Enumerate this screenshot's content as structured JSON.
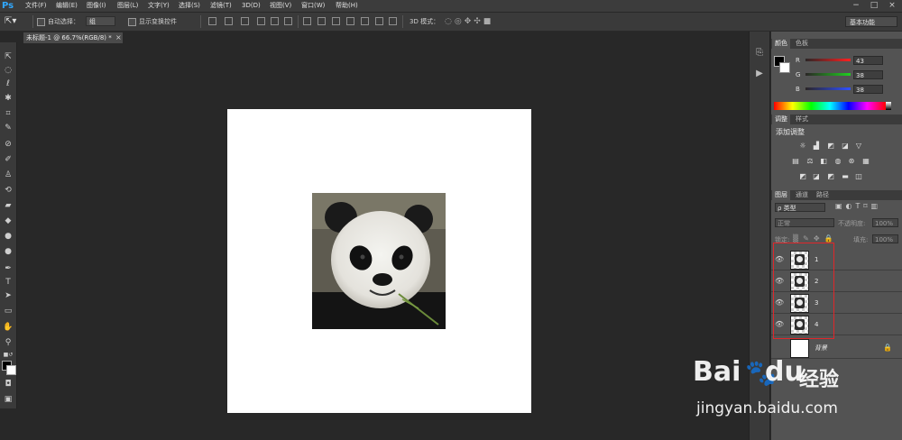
{
  "app": {
    "logo": "Ps"
  },
  "menu": [
    "文件(F)",
    "编辑(E)",
    "图像(I)",
    "图层(L)",
    "文字(Y)",
    "选择(S)",
    "滤镜(T)",
    "3D(D)",
    "视图(V)",
    "窗口(W)",
    "帮助(H)"
  ],
  "window_controls": [
    "−",
    "□",
    "×"
  ],
  "options": {
    "auto_select_label": "自动选择：",
    "auto_select_value": "组",
    "show_transform_label": "显示变换控件",
    "mode_3d_label": "3D 模式：",
    "workspace": "基本功能"
  },
  "document_tab": {
    "title": "未标题-1 @ 66.7%(RGB/8) *",
    "close": "×"
  },
  "colors": {
    "canvas_bg": "#ffffff",
    "app_bg": "#282828",
    "panel_bg": "#535353",
    "highlight": "#e0262a",
    "foreground": "#000000",
    "background": "#ffffff"
  },
  "color_panel": {
    "tabs": [
      "颜色",
      "色板"
    ],
    "channels": [
      {
        "label": "R",
        "value": "43",
        "color": "#ff2020"
      },
      {
        "label": "G",
        "value": "38",
        "color": "#20d020"
      },
      {
        "label": "B",
        "value": "38",
        "color": "#3050ff"
      }
    ]
  },
  "adjust_panel": {
    "tabs": [
      "调整",
      "样式"
    ],
    "title": "添加调整"
  },
  "layers_panel": {
    "tabs": [
      "图层",
      "通道",
      "路径"
    ],
    "filter_label": "ρ 类型",
    "blend_mode": "正常",
    "opacity_label": "不透明度:",
    "opacity_value": "100%",
    "lock_label": "锁定:",
    "fill_label": "填充:",
    "fill_value": "100%",
    "layers": [
      {
        "name": "1"
      },
      {
        "name": "2"
      },
      {
        "name": "3"
      },
      {
        "name": "4"
      }
    ],
    "background_layer": {
      "name": "背景"
    }
  },
  "watermark": {
    "brand": "Bai",
    "brand2": "du",
    "cn": "经验",
    "url": "jingyan.baidu.com"
  }
}
